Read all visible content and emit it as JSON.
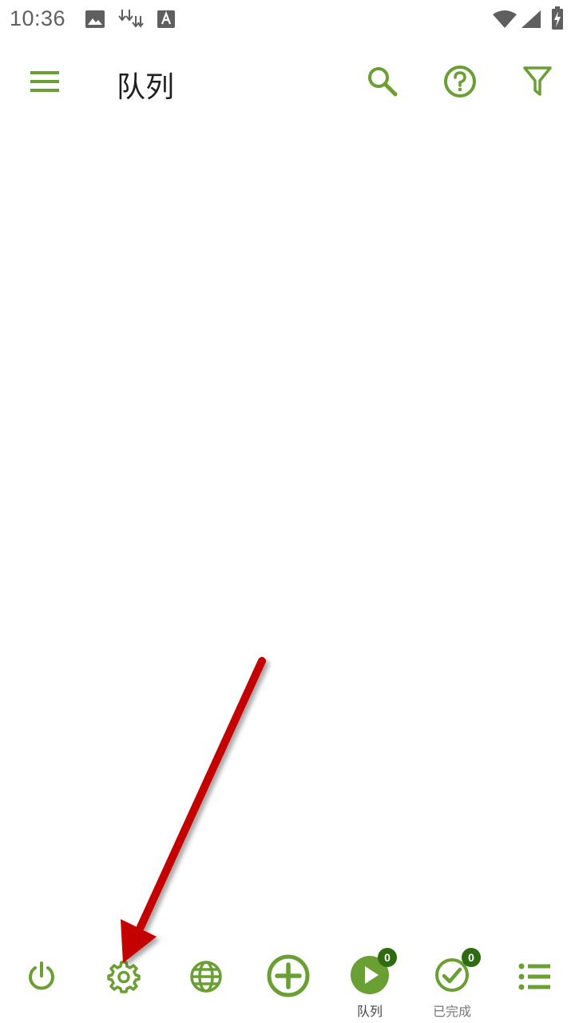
{
  "status_bar": {
    "time": "10:36",
    "icons": [
      "image-notification-icon",
      "download-arrows-icon",
      "font-a-icon",
      "wifi-icon",
      "cell-signal-icon",
      "battery-charging-icon"
    ]
  },
  "app_bar": {
    "title": "队列",
    "icons": [
      "menu-icon",
      "search-icon",
      "help-icon",
      "filter-icon"
    ]
  },
  "bottom_nav": {
    "items": [
      {
        "name": "power",
        "label": ""
      },
      {
        "name": "settings",
        "label": ""
      },
      {
        "name": "globe",
        "label": ""
      },
      {
        "name": "add",
        "label": ""
      },
      {
        "name": "queue",
        "label": "队列",
        "badge": "0"
      },
      {
        "name": "completed",
        "label": "已完成",
        "badge": "0"
      },
      {
        "name": "list",
        "label": ""
      }
    ]
  },
  "colors": {
    "accent": "#6a9f33",
    "badge": "#2f6b10",
    "arrow": "#c40000",
    "text": "#1f1f1f"
  }
}
